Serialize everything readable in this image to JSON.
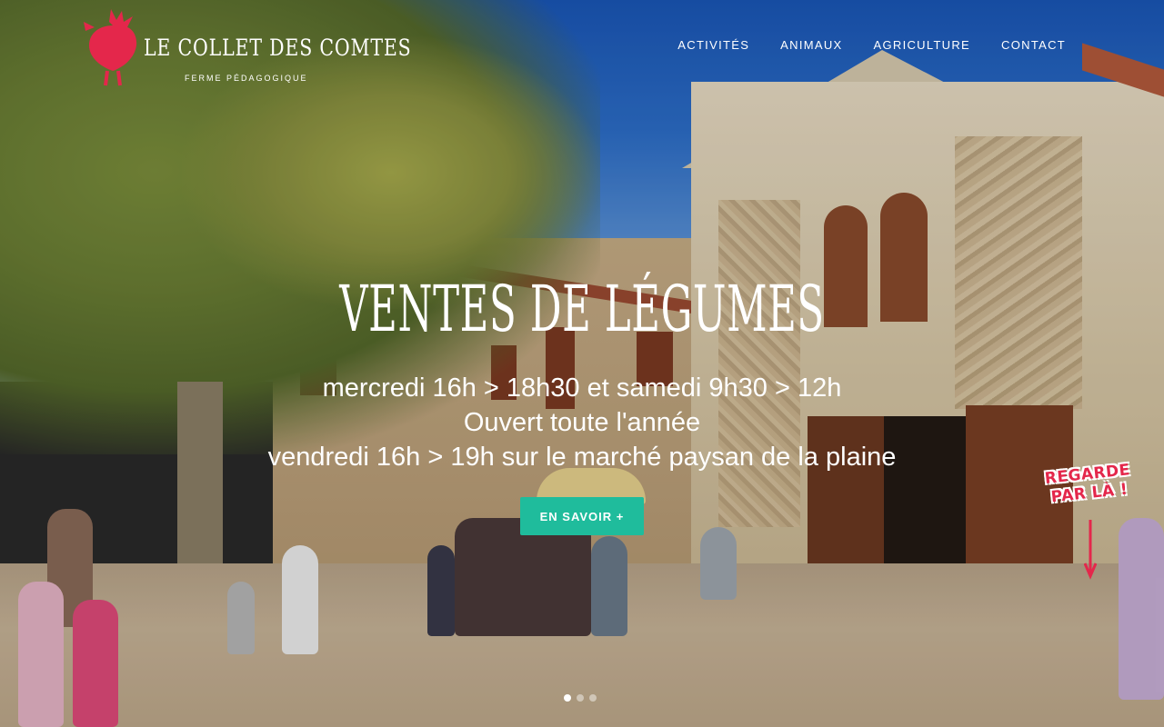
{
  "brand": {
    "title": "Le Collet des Comtes",
    "subtitle": "FERME PÉDAGOGIQUE",
    "logo_icon": "rooster-logo-icon",
    "accent_color": "#e4274b"
  },
  "nav": {
    "items": [
      {
        "label": "ACTIVITÉS"
      },
      {
        "label": "ANIMAUX"
      },
      {
        "label": "AGRICULTURE"
      },
      {
        "label": "CONTACT"
      }
    ]
  },
  "hero": {
    "title": "Ventes de légumes",
    "lines": [
      "mercredi 16h > 18h30 et samedi 9h30 > 12h",
      "Ouvert toute l'année",
      "vendredi 16h > 19h sur le marché paysan de la plaine"
    ],
    "cta_label": "EN SAVOIR +",
    "cta_color": "#1fbc9c",
    "photo_sign": "REGARDE PAR LÀ !"
  },
  "slider": {
    "slide_count": 3,
    "active_index": 0
  }
}
